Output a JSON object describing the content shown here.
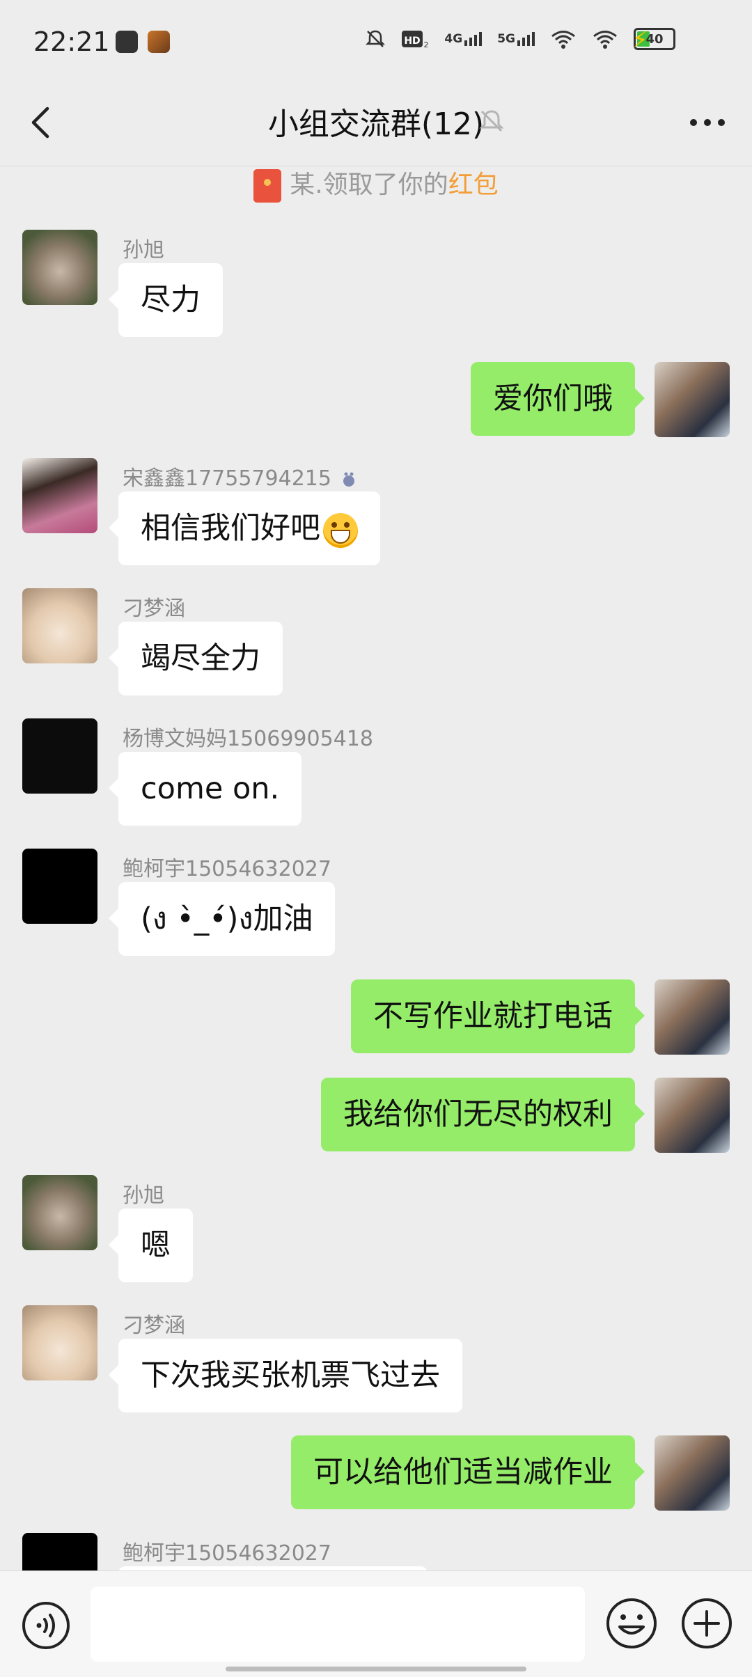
{
  "status_bar": {
    "time": "22:21",
    "indicators": [
      "bell-off-icon",
      "hd-icon",
      "4g-signal-icon",
      "5g-signal-icon",
      "wifi-icon",
      "wifi-icon"
    ],
    "network_4g": "4G",
    "network_5g": "5G",
    "battery_level": "40",
    "charging": true
  },
  "header": {
    "title": "小组交流群(12)",
    "muted": true
  },
  "system_message": {
    "prefix": "某.领取了你的",
    "link": "红包"
  },
  "messages": [
    {
      "side": "left",
      "name": "孙旭",
      "text": "尽力",
      "avatar": "monkey"
    },
    {
      "side": "right",
      "text": "爱你们哦",
      "avatar": "family"
    },
    {
      "side": "left",
      "name": "宋鑫鑫17755794215",
      "text": "相信我们好吧",
      "avatar": "girl",
      "emoji": "grin-emoji"
    },
    {
      "side": "left",
      "name": "刁梦涵",
      "text": "竭尽全力",
      "avatar": "cat"
    },
    {
      "side": "left",
      "name": "杨博文妈妈15069905418",
      "text": "come on.",
      "avatar": "dark"
    },
    {
      "side": "left",
      "name": "鲍柯宇15054632027",
      "text": "(ง •̀_•́)ง加油",
      "avatar": "black"
    },
    {
      "side": "right",
      "text": "不写作业就打电话",
      "avatar": "family"
    },
    {
      "side": "right",
      "text": "我给你们无尽的权利",
      "avatar": "family"
    },
    {
      "side": "left",
      "name": "孙旭",
      "text": "嗯",
      "avatar": "monkey"
    },
    {
      "side": "left",
      "name": "刁梦涵",
      "text": "下次我买张机票飞过去",
      "avatar": "cat"
    },
    {
      "side": "right",
      "text": "可以给他们适当减作业",
      "avatar": "family"
    },
    {
      "side": "left",
      "name": "鲍柯宇15054632027",
      "text": "",
      "avatar": "black"
    }
  ],
  "input_bar": {
    "value": "",
    "icons": [
      "voice-icon",
      "emoji-icon",
      "plus-icon"
    ]
  },
  "colors": {
    "background": "#ededed",
    "outgoing_bubble": "#95ec69",
    "incoming_bubble": "#ffffff",
    "red_packet_link": "#f29e38"
  }
}
